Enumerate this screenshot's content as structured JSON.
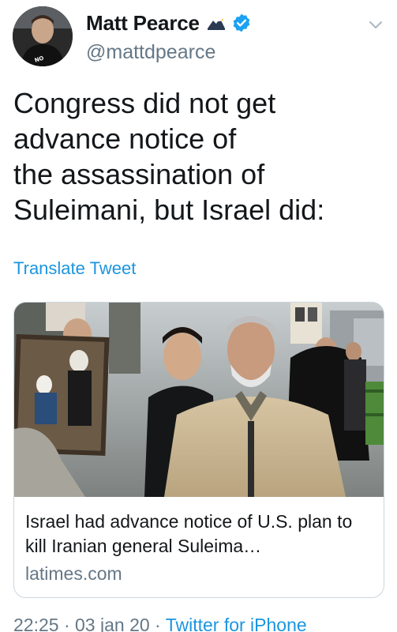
{
  "author": {
    "display_name": "Matt Pearce",
    "handle": "@mattdpearce",
    "avatar_badge_text": "NO COMMENT",
    "name_emoji": "eagle-emoji",
    "verified_icon": "verified-badge-icon"
  },
  "tweet": {
    "text": "Congress did not get\nadvance notice of\nthe assassination of\nSuleimani, but Israel did:",
    "translate_label": "Translate Tweet"
  },
  "link_card": {
    "image_alt": "article-photo",
    "title": "Israel had advance notice of U.S. plan to kill Iranian general Suleima…",
    "domain": "latimes.com"
  },
  "meta": {
    "time": "22:25",
    "separator": "·",
    "date": "03 jan 20",
    "source": "Twitter for iPhone"
  },
  "colors": {
    "link": "#1b95e0",
    "secondary_text": "#657786",
    "primary_text": "#14171a",
    "card_border": "#ccd6dd",
    "verified": "#1da1f2"
  }
}
